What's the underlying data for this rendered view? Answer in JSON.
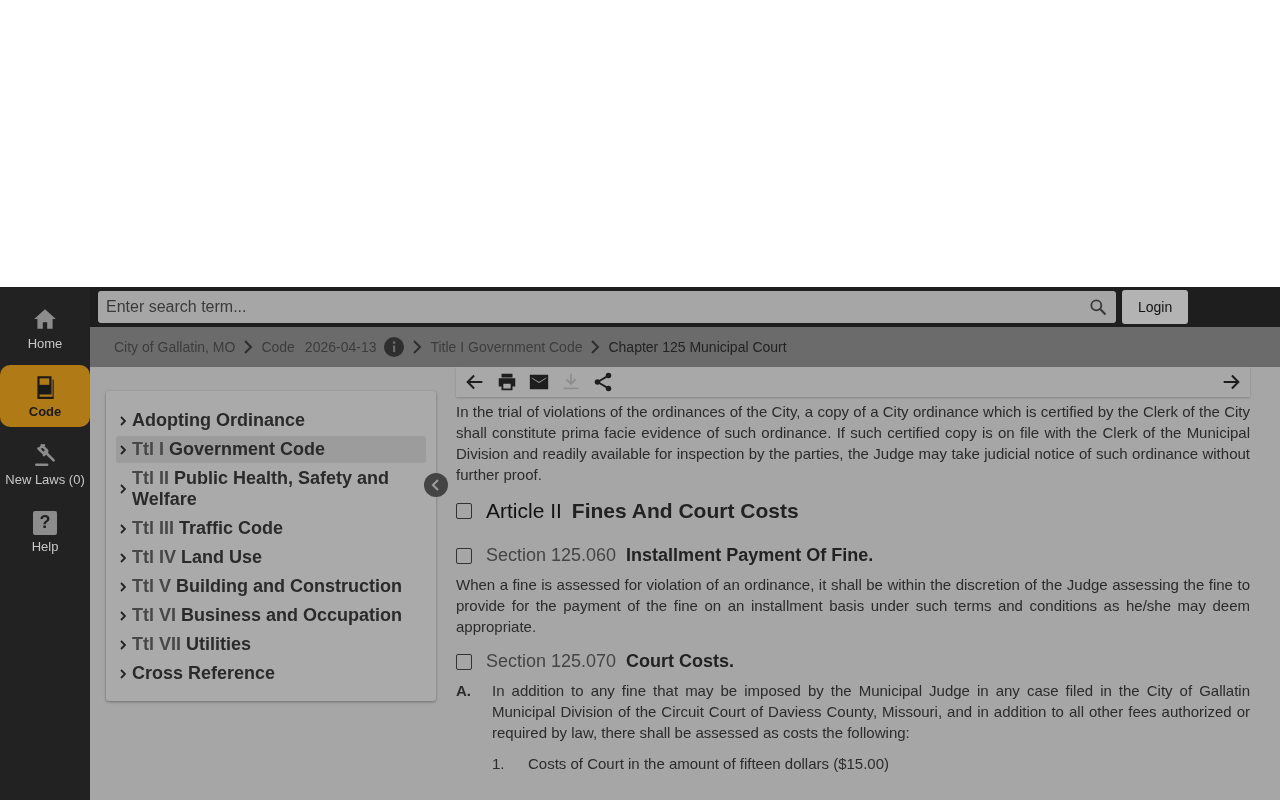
{
  "nav": [
    {
      "kind": "home",
      "label": "Home",
      "selected": false
    },
    {
      "kind": "code",
      "label": "Code",
      "selected": true
    },
    {
      "kind": "gavel",
      "label": "New Laws (0)",
      "selected": false
    },
    {
      "kind": "help",
      "label": "Help",
      "icon_text": "?",
      "selected": false
    }
  ],
  "search": {
    "placeholder": "Enter search term..."
  },
  "login_button": "Login",
  "breadcrumbs": [
    {
      "label": "City of Gallatin, MO",
      "selected": false
    },
    {
      "label": "Code",
      "version": "2026-04-13",
      "selected": false
    },
    {
      "label": "Title I Government Code",
      "selected": false
    },
    {
      "label": "Chapter 125 Municipal Court",
      "selected": true
    }
  ],
  "toc": [
    {
      "title": "Adopting Ordinance",
      "selected": false
    },
    {
      "prefix": "Ttl I",
      "title": "Government Code",
      "selected": true
    },
    {
      "prefix": "Ttl II",
      "title": "Public Health, Safety and Welfare",
      "selected": false
    },
    {
      "prefix": "Ttl III",
      "title": "Traffic Code",
      "selected": false
    },
    {
      "prefix": "Ttl IV",
      "title": "Land Use",
      "selected": false
    },
    {
      "prefix": "Ttl V",
      "title": "Building and Construction",
      "selected": false
    },
    {
      "prefix": "Ttl VI",
      "title": "Business and Occupation",
      "selected": false
    },
    {
      "prefix": "Ttl VII",
      "title": "Utilities",
      "selected": false
    },
    {
      "title": "Cross Reference",
      "selected": false
    }
  ],
  "toolbar": [
    {
      "kind": "back",
      "disabled": false
    },
    {
      "kind": "print",
      "disabled": false
    },
    {
      "kind": "email",
      "disabled": false
    },
    {
      "kind": "download",
      "disabled": true
    },
    {
      "kind": "share",
      "disabled": false
    },
    {
      "kind": "forward",
      "disabled": false
    }
  ],
  "content": [
    {
      "kind": "paragraph",
      "text": "In the trial of violations of the ordinances of the City, a copy of a City ordinance which is certified by the Clerk of the City shall constitute prima facie evidence of such ordinance. If such certified copy is on file with the Clerk of the Municipal Division and readily available for inspection by the parties, the Judge may take judicial notice of such ordinance without further proof."
    },
    {
      "kind": "article",
      "number": "Article II",
      "title": "Fines And Court Costs",
      "checked": false
    },
    {
      "kind": "section",
      "number": "Section 125.060",
      "title": "Installment Payment Of Fine.",
      "checked": false
    },
    {
      "kind": "paragraph",
      "text": "When a fine is assessed for violation of an ordinance, it shall be within the discretion of the Judge assessing the fine to provide for the payment of the fine on an installment basis under such terms and conditions as he/she may deem appropriate."
    },
    {
      "kind": "section",
      "number": "Section 125.070",
      "title": "Court Costs.",
      "checked": false
    },
    {
      "kind": "item",
      "marker": "A.",
      "text": "In addition to any fine that may be imposed by the Municipal Judge in any case filed in the City of Gallatin Municipal Division of the Circuit Court of Daviess County, Missouri, and in addition to all other fees authorized or required by law, there shall be assessed as costs the following:"
    },
    {
      "kind": "subitem",
      "marker": "1.",
      "text": "Costs of Court in the amount of fifteen dollars ($15.00)"
    }
  ]
}
